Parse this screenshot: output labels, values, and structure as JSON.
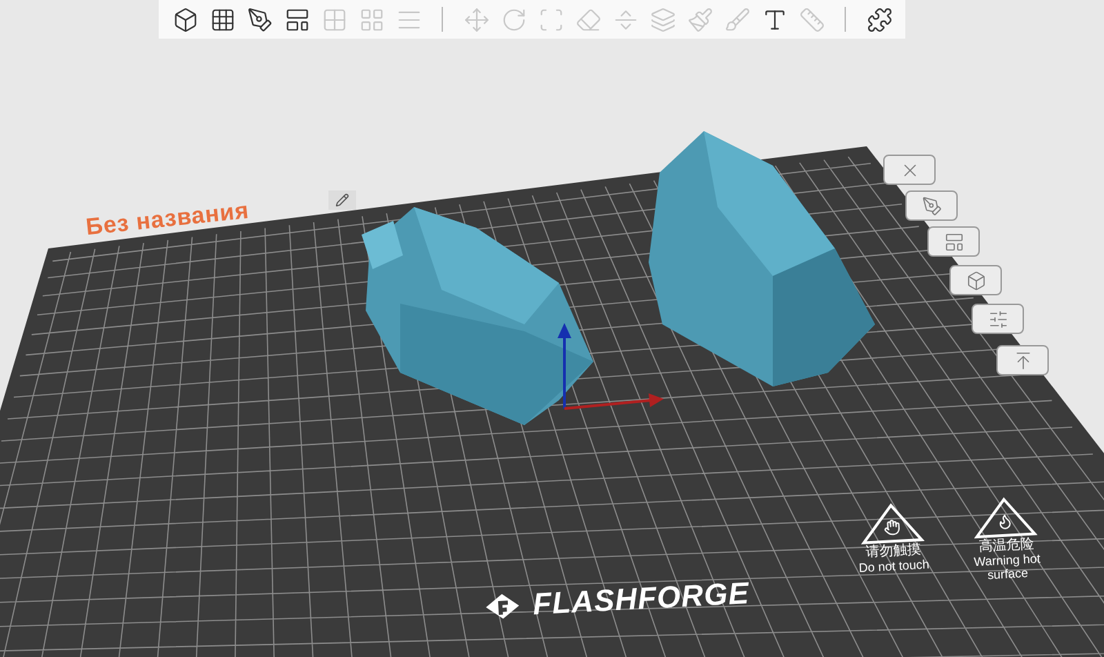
{
  "toolbar": {
    "groups": [
      {
        "items": [
          {
            "disabled": false
          },
          {
            "disabled": false
          },
          {
            "disabled": false
          },
          {
            "disabled": false
          },
          {
            "disabled": true
          },
          {
            "disabled": true
          },
          {
            "disabled": true
          }
        ]
      },
      {
        "items": [
          {
            "disabled": true
          },
          {
            "disabled": true
          },
          {
            "disabled": true
          },
          {
            "disabled": true
          },
          {
            "disabled": true
          },
          {
            "disabled": true
          },
          {
            "disabled": true
          },
          {
            "disabled": true
          },
          {
            "disabled": false
          },
          {
            "disabled": true
          }
        ]
      },
      {
        "items": [
          {
            "disabled": false
          }
        ]
      }
    ]
  },
  "plate": {
    "name": "Без названия",
    "brand": "FLASHFORGE",
    "tools": [
      {
        "disabled": false
      },
      {
        "disabled": false
      },
      {
        "disabled": false
      },
      {
        "disabled": false
      },
      {
        "disabled": false
      },
      {
        "disabled": false
      }
    ],
    "warnings": [
      {
        "kind": "no-touch",
        "caption_cjk": "请勿触摸",
        "caption": "Do not touch"
      },
      {
        "kind": "hot",
        "caption_cjk": "高温危险",
        "caption": "Warning hot surface"
      }
    ]
  }
}
